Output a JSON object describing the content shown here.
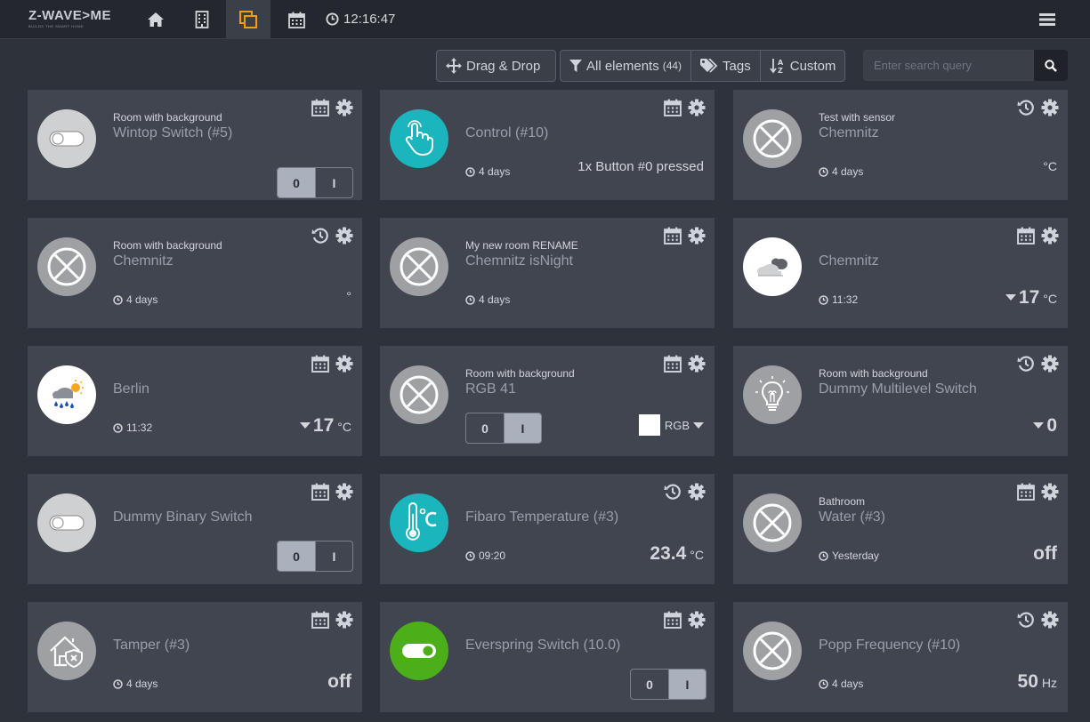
{
  "header": {
    "logo_text": "Z-WAVE>ME",
    "logo_tagline": "BUILDS THE SMART HOME",
    "clock": "12:16:47",
    "nav_icons": [
      "home-icon",
      "building-icon",
      "elements-icon",
      "calendar-icon"
    ],
    "active_nav": "elements-icon"
  },
  "toolbar": {
    "drag_drop": "Drag & Drop",
    "all_elements": "All elements",
    "all_count": "(44)",
    "tags": "Tags",
    "custom": "Custom",
    "search_placeholder": "Enter search query"
  },
  "colors": {
    "accent_orange": "#f39c12",
    "teal": "#1ab5bd",
    "green": "#4cae19",
    "card_bg": "#41454f",
    "page_bg": "#2e323b"
  },
  "cards": [
    {
      "room": "Room with background",
      "title": "Wintop Switch (#5)",
      "age": "",
      "icons": [
        "calendar-icon",
        "gear-icon"
      ],
      "avatar": "switch-off-icon",
      "switch": {
        "off": "0",
        "on": "I",
        "active": "0"
      }
    },
    {
      "room": "",
      "title": "Control (#10)",
      "age": "4 days",
      "icons": [
        "calendar-icon",
        "gear-icon"
      ],
      "avatar": "touch-hand-icon",
      "level": "1x Button #0 pressed"
    },
    {
      "room": "Test with sensor",
      "title": "Chemnitz",
      "age": "4 days",
      "icons": [
        "history-icon",
        "gear-icon"
      ],
      "avatar": "no-icon",
      "level_unit": "°C"
    },
    {
      "room": "Room with background",
      "title": "Chemnitz",
      "age": "4 days",
      "icons": [
        "history-icon",
        "gear-icon"
      ],
      "avatar": "no-icon",
      "level_unit": "°"
    },
    {
      "room": "My new room RENAME",
      "title": "Chemnitz isNight",
      "age": "4 days",
      "icons": [
        "calendar-icon",
        "gear-icon"
      ],
      "avatar": "no-icon"
    },
    {
      "room": "",
      "title": "Chemnitz",
      "age": "11:32",
      "icons": [
        "calendar-icon",
        "gear-icon"
      ],
      "avatar": "cloud-weather-icon",
      "level": "17",
      "level_unit": "°C"
    },
    {
      "room": "",
      "title": "Berlin",
      "age": "11:32",
      "icons": [
        "calendar-icon",
        "gear-icon"
      ],
      "avatar": "rain-weather-icon",
      "level": "17",
      "level_unit": "°C"
    },
    {
      "room": "Room with background",
      "title": "RGB 41",
      "age": "",
      "icons": [
        "calendar-icon",
        "gear-icon"
      ],
      "avatar": "no-icon",
      "switch": {
        "off": "0",
        "on": "I",
        "active": "I"
      },
      "rgb_label": "RGB",
      "rgb_color": "#ffffff"
    },
    {
      "room": "Room with background",
      "title": "Dummy Multilevel Switch",
      "age": "",
      "icons": [
        "history-icon",
        "gear-icon"
      ],
      "avatar": "light-bulb-icon",
      "level": "0"
    },
    {
      "room": "",
      "title": "Dummy Binary Switch",
      "age": "",
      "icons": [
        "calendar-icon",
        "gear-icon"
      ],
      "avatar": "switch-off-icon",
      "switch": {
        "off": "0",
        "on": "I",
        "active": "0"
      }
    },
    {
      "room": "",
      "title": "Fibaro Temperature (#3)",
      "age": "09:20",
      "icons": [
        "history-icon",
        "gear-icon"
      ],
      "avatar": "thermometer-icon",
      "level": "23.4",
      "level_unit": "°C"
    },
    {
      "room": "Bathroom",
      "title": "Water (#3)",
      "age": "Yesterday",
      "icons": [
        "calendar-icon",
        "gear-icon"
      ],
      "avatar": "no-icon",
      "level": "off"
    },
    {
      "room": "",
      "title": "Tamper (#3)",
      "age": "4 days",
      "icons": [
        "calendar-icon",
        "gear-icon"
      ],
      "avatar": "house-alarm-icon",
      "level": "off"
    },
    {
      "room": "",
      "title": "Everspring Switch (10.0)",
      "age": "",
      "icons": [
        "calendar-icon",
        "gear-icon"
      ],
      "avatar": "switch-on-icon",
      "switch": {
        "off": "0",
        "on": "I",
        "active": "I"
      }
    },
    {
      "room": "",
      "title": "Popp Frequency (#10)",
      "age": "4 days",
      "icons": [
        "history-icon",
        "gear-icon"
      ],
      "avatar": "no-icon",
      "level": "50",
      "level_unit": "Hz"
    }
  ]
}
